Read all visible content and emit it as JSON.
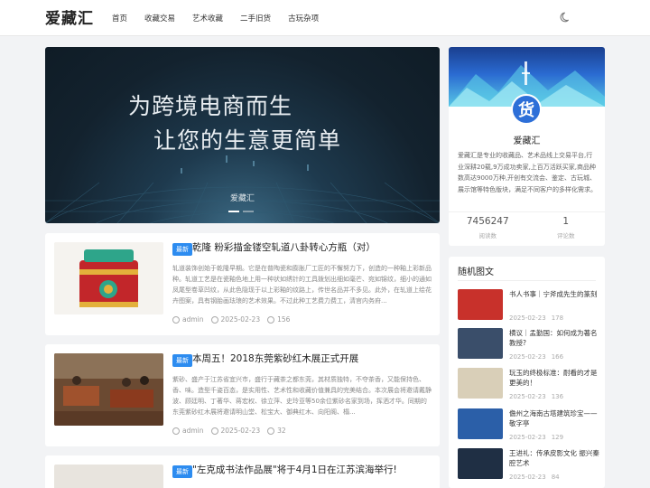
{
  "header": {
    "logo": "爱藏汇",
    "nav": [
      "首页",
      "收藏交易",
      "艺术收藏",
      "二手旧货",
      "古玩杂项"
    ]
  },
  "banner": {
    "line1": "为跨境电商而生",
    "line2": "让您的生意更简单",
    "caption": "爱藏汇"
  },
  "posts": [
    {
      "badge": "最新",
      "title": "乾隆 粉彩描金镂空轧道八卦转心方瓶（对）",
      "excerpt": "轧道装饰创始于乾隆早期。它是在普陶瓷和膨胀厂工匠的不懈努力下，创造的一种釉上彩新品种。轧道工艺是在瓷釉色地上用一种状如绣针的工具拨划出细如毫芒、宛如锦纹，细小的通如凤尾型卷草凹纹，从此色隐现于以上彩釉的纹路上，传世名品并不多见。此外，在轧道上绘花卉图案，具有钢胎画珐琅的艺术效果。不过此种工艺费力费工，清官内务府...",
      "author": "admin",
      "date": "2025-02-23",
      "views": "156"
    },
    {
      "badge": "最新",
      "title": "本周五！2018东莞紫砂红木展正式开展",
      "excerpt": "紫砂、盛产于江苏省宜兴市，盛行于藏茶之都东莞，其材质独特，不夺茶香，又能保持色、香、味。造型千姿百态，是实用性、艺术性和收藏价值兼具的完美结合。本次展会将邀请戴静波、顾廷明、丁著华、蒋宏权、徐立萍、史玲亚等50余位紫砂名家到场，挥洒才华。同期的东莞紫砂红木展将邀请明山堂、松宝大、御典红木、向阳阁、榻...",
      "author": "admin",
      "date": "2025-02-23",
      "views": "32"
    },
    {
      "badge": "最新",
      "title": "\"左克成书法作品展\"将于4月1日在江苏滨海举行!",
      "excerpt": "",
      "author": "",
      "date": "",
      "views": ""
    }
  ],
  "profile": {
    "avatar_text": "货",
    "name": "爱藏汇",
    "desc": "爱藏汇是专业的收藏品、艺术品线上交易平台,行业深耕20载,9万成功卖家,上百万活跃买家,商品种数高达9000万种,开创有交流会、鉴定、古玩城、展示馆等特色版块，满足不同客户的多样化需求。",
    "stats": [
      {
        "value": "7456247",
        "label": "阅读数"
      },
      {
        "value": "1",
        "label": "评论数"
      }
    ]
  },
  "random": {
    "title": "随机图文",
    "items": [
      {
        "title": "书人书事｜宁斧成先生的篆刻",
        "date": "2025-02-23",
        "views": "178",
        "color": "#c8312b"
      },
      {
        "title": "横议｜孟勤国：如何成为著名教授?",
        "date": "2025-02-23",
        "views": "166",
        "color": "#3a4e6a"
      },
      {
        "title": "玩玉的终极标准：耐看的才是更美的！",
        "date": "2025-02-23",
        "views": "136",
        "color": "#d9cfb8"
      },
      {
        "title": "儋州之海南古塔建筑珍宝——敬字亭",
        "date": "2025-02-23",
        "views": "129",
        "color": "#2b5fa8"
      },
      {
        "title": "王进礼：传承皮影文化 振兴秦腔艺术",
        "date": "2025-02-23",
        "views": "84",
        "color": "#1f2f44"
      }
    ]
  },
  "colors": {
    "accent": "#2d8cf0"
  }
}
